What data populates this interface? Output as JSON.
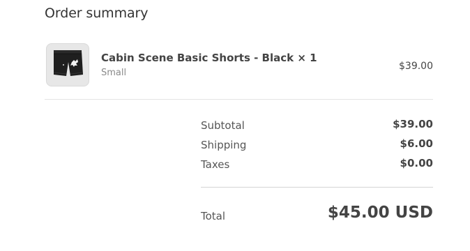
{
  "summary": {
    "heading": "Order summary"
  },
  "item": {
    "name": "Cabin Scene Basic Shorts - Black × 1",
    "variant": "Small",
    "price": "$39.00",
    "image_icon": "shorts-product-image"
  },
  "totals": {
    "subtotal_label": "Subtotal",
    "subtotal_value": "$39.00",
    "shipping_label": "Shipping",
    "shipping_value": "$6.00",
    "taxes_label": "Taxes",
    "taxes_value": "$0.00",
    "total_label": "Total",
    "total_value": "$45.00 USD"
  }
}
